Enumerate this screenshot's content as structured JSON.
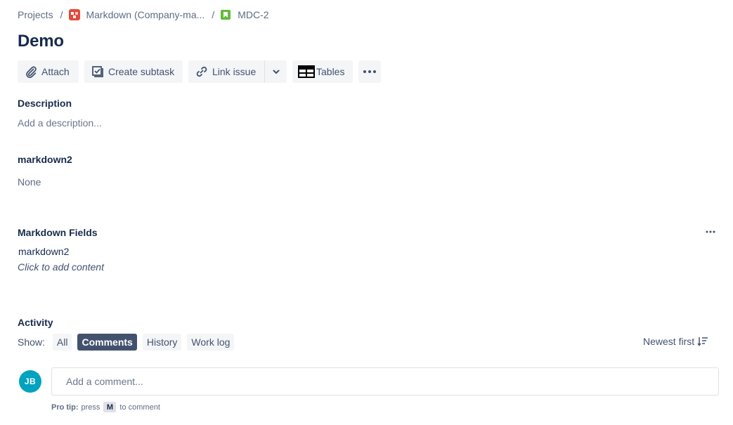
{
  "breadcrumb": {
    "projects": "Projects",
    "separator": "/",
    "project": "Markdown (Company-ma...",
    "issue_key": "MDC-2"
  },
  "issue": {
    "title": "Demo"
  },
  "toolbar": {
    "attach": "Attach",
    "create_subtask": "Create subtask",
    "link_issue": "Link issue",
    "tables": "Tables"
  },
  "description": {
    "label": "Description",
    "placeholder": "Add a description..."
  },
  "markdown2_field": {
    "label": "markdown2",
    "value": "None"
  },
  "markdown_fields": {
    "label": "Markdown Fields",
    "field_name": "markdown2",
    "click_hint": "Click to add content"
  },
  "activity": {
    "label": "Activity",
    "show_label": "Show:",
    "filters": [
      "All",
      "Comments",
      "History",
      "Work log"
    ],
    "active_filter": "Comments",
    "sort_label": "Newest first"
  },
  "comment": {
    "avatar_initials": "JB",
    "placeholder": "Add a comment...",
    "pro_tip_label": "Pro tip:",
    "pro_tip_press": "press",
    "pro_tip_key": "M",
    "pro_tip_suffix": "to comment"
  },
  "icons": {
    "project_icon_color": "#e5493a",
    "issue_icon_color": "#63ba3c",
    "avatar_color": "#00a3bf"
  }
}
